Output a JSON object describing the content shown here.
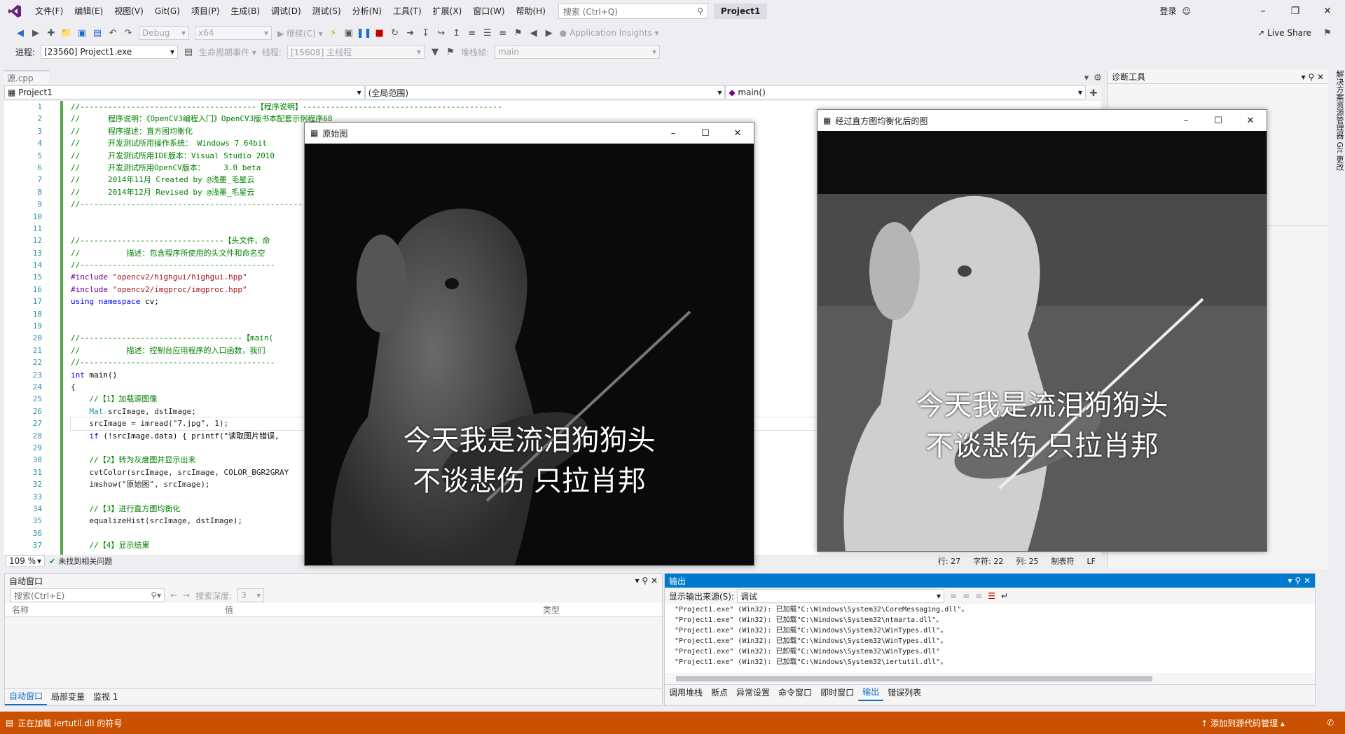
{
  "menu": [
    "文件(F)",
    "编辑(E)",
    "视图(V)",
    "Git(G)",
    "项目(P)",
    "生成(B)",
    "调试(D)",
    "测试(S)",
    "分析(N)",
    "工具(T)",
    "扩展(X)",
    "窗口(W)",
    "帮助(H)"
  ],
  "search_placeholder": "搜索 (Ctrl+Q)",
  "project_title": "Project1",
  "login": "登录",
  "toolbar1": {
    "config": "Debug",
    "platform": "x64",
    "continue": "继续(C)",
    "app_insights": "Application Insights",
    "live_share": "Live Share"
  },
  "toolbar2": {
    "process_label": "进程:",
    "process": "[23560] Project1.exe",
    "lifecycle": "生命周期事件",
    "thread_label": "线程:",
    "thread": "[15608] 主线程",
    "stack_label": "堆栈帧:",
    "stack": "main"
  },
  "editor": {
    "tab": "源.cpp",
    "nav_project": "Project1",
    "nav_scope": "(全局范围)",
    "nav_func": "main()",
    "line_numbers": [
      "1",
      "2",
      "3",
      "4",
      "5",
      "6",
      "7",
      "8",
      "9",
      "10",
      "11",
      "12",
      "13",
      "14",
      "15",
      "16",
      "17",
      "18",
      "19",
      "20",
      "21",
      "22",
      "23",
      "24",
      "25",
      "26",
      "27",
      "28",
      "29",
      "30",
      "31",
      "32",
      "33",
      "34",
      "35",
      "36",
      "37"
    ],
    "zoom": "109 %",
    "issues": "未找到相关问题",
    "pos_line": "行: 27",
    "pos_char": "字符: 22",
    "pos_col": "列: 25",
    "tab_mode": "制表符",
    "eol": "LF"
  },
  "code_lines": [
    {
      "cls": "c",
      "text": "//--------------------------------------【程序说明】-------------------------------------------"
    },
    {
      "cls": "c",
      "text": "//      程序说明：《OpenCV3编程入门》OpenCV3版书本配套示例程序68"
    },
    {
      "cls": "c",
      "text": "//      程序描述：直方图均衡化"
    },
    {
      "cls": "c",
      "text": "//      开发测试所用操作系统： Windows 7 64bit"
    },
    {
      "cls": "c",
      "text": "//      开发测试所用IDE版本：Visual Studio 2010"
    },
    {
      "cls": "c",
      "text": "//      开发测试所用OpenCV版本：    3.0 beta"
    },
    {
      "cls": "c",
      "text": "//      2014年11月 Created by @浅墨_毛星云"
    },
    {
      "cls": "c",
      "text": "//      2014年12月 Revised by @浅墨_毛星云"
    },
    {
      "cls": "c",
      "text": "//------------------------------------------------------------------------------------------------"
    },
    {
      "cls": "",
      "text": ""
    },
    {
      "cls": "",
      "text": ""
    },
    {
      "cls": "c",
      "text": "//-------------------------------【头文件、命"
    },
    {
      "cls": "c",
      "text": "//          描述：包含程序所使用的头文件和命名空"
    },
    {
      "cls": "c",
      "text": "//------------------------------------------"
    },
    {
      "cls": "inc",
      "text": "#include \"opencv2/highgui/highgui.hpp\""
    },
    {
      "cls": "inc",
      "text": "#include \"opencv2/imgproc/imgproc.hpp\""
    },
    {
      "cls": "use",
      "text": "using namespace cv;"
    },
    {
      "cls": "",
      "text": ""
    },
    {
      "cls": "",
      "text": ""
    },
    {
      "cls": "c",
      "text": "//-----------------------------------【main("
    },
    {
      "cls": "c",
      "text": "//          描述：控制台应用程序的入口函数，我们"
    },
    {
      "cls": "c",
      "text": "//------------------------------------------"
    },
    {
      "cls": "fn",
      "text": "int main()"
    },
    {
      "cls": "",
      "text": "{"
    },
    {
      "cls": "c",
      "text": "    //【1】加载源图像"
    },
    {
      "cls": "mat",
      "text": "    Mat srcImage, dstImage;"
    },
    {
      "cls": "",
      "text": "    srcImage = imread(\"7.jpg\", 1);"
    },
    {
      "cls": "if",
      "text": "    if (!srcImage.data) { printf(\"读取图片错误,"
    },
    {
      "cls": "",
      "text": ""
    },
    {
      "cls": "c",
      "text": "    //【2】转为灰度图并显示出来"
    },
    {
      "cls": "",
      "text": "    cvtColor(srcImage, srcImage, COLOR_BGR2GRAY"
    },
    {
      "cls": "",
      "text": "    imshow(\"原始图\", srcImage);"
    },
    {
      "cls": "",
      "text": ""
    },
    {
      "cls": "c",
      "text": "    //【3】进行直方图均衡化"
    },
    {
      "cls": "",
      "text": "    equalizeHist(srcImage, dstImage);"
    },
    {
      "cls": "",
      "text": ""
    },
    {
      "cls": "c",
      "text": "    //【4】显示结果"
    }
  ],
  "win_original": {
    "title": "原始图",
    "caption1": "今天我是流泪狗狗头",
    "caption2": "不谈悲伤 只拉肖邦"
  },
  "win_equalized": {
    "title": "经过直方图均衡化后的图",
    "caption1": "今天我是流泪狗狗头",
    "caption2": "不谈悲伤 只拉肖邦"
  },
  "diag": {
    "title": "诊断工具"
  },
  "sidestrip": "解决方案资源管理器  Git 更改",
  "autos": {
    "title": "自动窗口",
    "search": "搜索(Ctrl+E)",
    "depth_label": "搜索深度:",
    "depth": "3",
    "col_name": "名称",
    "col_value": "值",
    "col_type": "类型",
    "tabs": [
      "自动窗口",
      "局部变量",
      "监视 1"
    ]
  },
  "output": {
    "title": "输出",
    "source_label": "显示输出来源(S):",
    "source": "调试",
    "lines": [
      "\"Project1.exe\" (Win32): 已加载\"C:\\Windows\\System32\\CoreMessaging.dll\"。",
      "\"Project1.exe\" (Win32): 已加载\"C:\\Windows\\System32\\ntmarta.dll\"。",
      "\"Project1.exe\" (Win32): 已加载\"C:\\Windows\\System32\\WinTypes.dll\"。",
      "\"Project1.exe\" (Win32): 已加载\"C:\\Windows\\System32\\WinTypes.dll\"。",
      "\"Project1.exe\" (Win32): 已卸载\"C:\\Windows\\System32\\WinTypes.dll\"",
      "\"Project1.exe\" (Win32): 已加载\"C:\\Windows\\System32\\iertutil.dll\"。"
    ],
    "tabs": [
      "调用堆栈",
      "断点",
      "异常设置",
      "命令窗口",
      "即时窗口",
      "输出",
      "错误列表"
    ]
  },
  "status": {
    "left": "正在加载 iertutil.dll 的符号",
    "right": "添加到源代码管理"
  },
  "colors": {
    "status": "#ca5100",
    "accent": "#007acc",
    "comment": "#008000"
  }
}
